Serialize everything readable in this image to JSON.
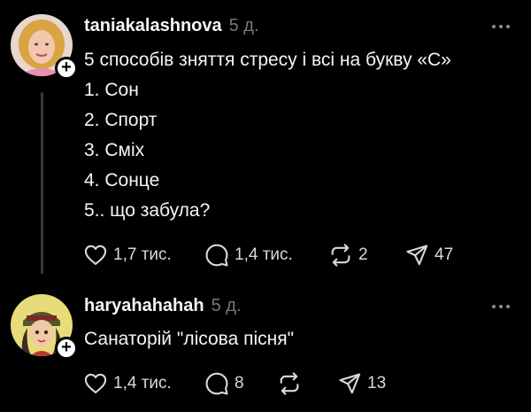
{
  "posts": [
    {
      "username": "taniakalashnova",
      "timestamp": "5 д.",
      "lines": [
        "5 способів зняття стресу і всі на букву «С»",
        "1. Сон",
        "2. Спорт",
        "3. Сміх",
        "4. Сонце",
        "5.. що забула?"
      ],
      "actions": {
        "likes": "1,7 тис.",
        "replies": "1,4 тис.",
        "reposts": "2",
        "shares": "47"
      }
    },
    {
      "username": "haryahahahah",
      "timestamp": "5 д.",
      "lines": [
        "Санаторій \"лісова пісня\""
      ],
      "actions": {
        "likes": "1,4 тис.",
        "replies": "8",
        "reposts": "",
        "shares": "13"
      }
    }
  ],
  "icons": {
    "like": "heart-icon",
    "reply": "comment-icon",
    "repost": "repost-icon",
    "share": "send-icon",
    "more": "more-dots-icon",
    "follow": "plus-icon"
  },
  "colors": {
    "background": "#000000",
    "text": "#f3f5f7",
    "muted": "#777777",
    "thread_line": "#3a3a3a"
  }
}
